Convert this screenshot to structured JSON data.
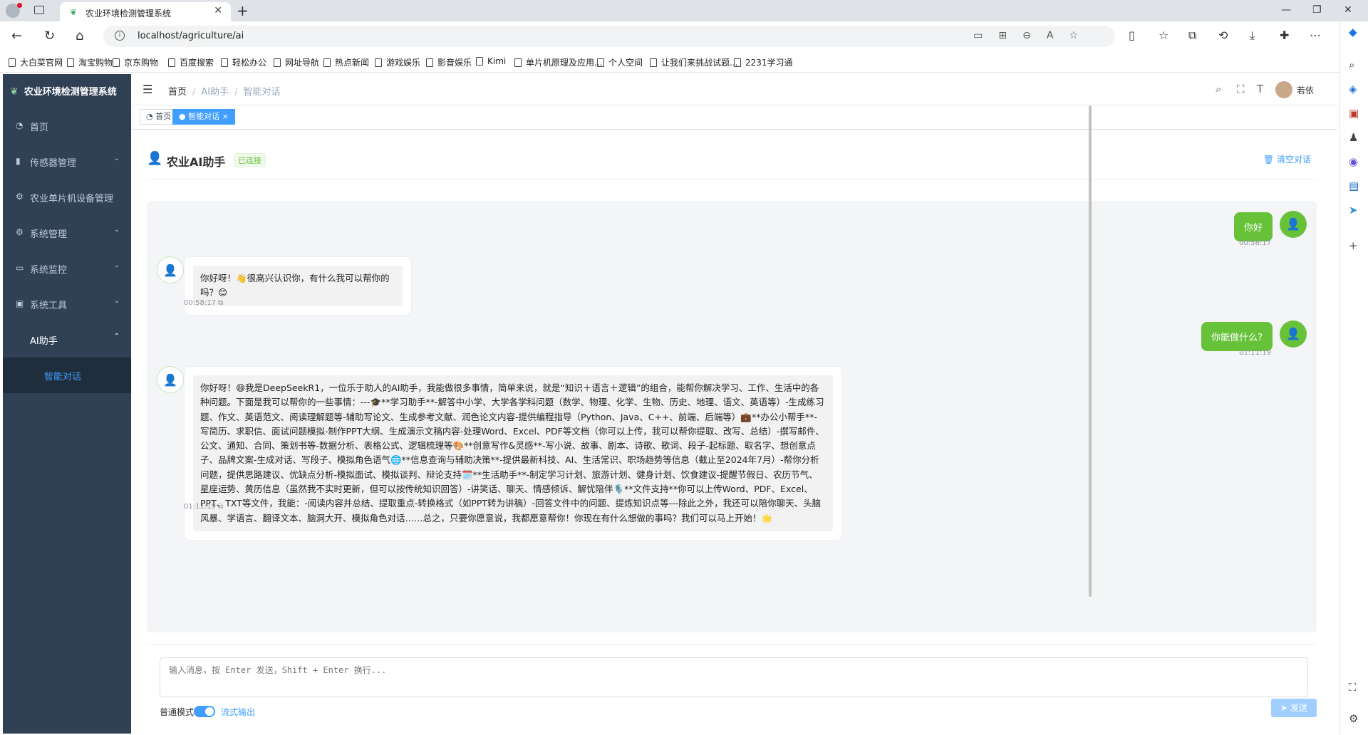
{
  "browser": {
    "tab_title": "农业环境检测管理系统",
    "url": "localhost/agriculture/ai",
    "bookmarks": [
      "大白菜官网",
      "淘宝购物",
      "京东购物",
      "百度搜索",
      "轻松办公",
      "网址导航",
      "热点新闻",
      "游戏娱乐",
      "影音娱乐",
      "Kimi",
      "单片机原理及应用...",
      "个人空间",
      "让我们来挑战试题...",
      "2231学习通"
    ]
  },
  "sidebar": {
    "logo": "农业环境检测管理系统",
    "items": [
      {
        "label": "首页",
        "icon": "dashboard-icon"
      },
      {
        "label": "传感器管理",
        "icon": "chart-icon"
      },
      {
        "label": "农业单片机设备管理",
        "icon": "gear-icon"
      },
      {
        "label": "系统管理",
        "icon": "gear-icon"
      },
      {
        "label": "系统监控",
        "icon": "monitor-icon"
      },
      {
        "label": "系统工具",
        "icon": "toolbox-icon"
      },
      {
        "label": "AI助手",
        "icon": ""
      },
      {
        "label": "智能对话",
        "icon": ""
      }
    ]
  },
  "navbar": {
    "breadcrumb": [
      "首页",
      "AI助手",
      "智能对话"
    ],
    "username": "若依"
  },
  "tags": {
    "home": "首页",
    "active": "智能对话"
  },
  "chat": {
    "title": "农业AI助手",
    "status": "已连接",
    "clear": "清空对话",
    "messages": [
      {
        "role": "user",
        "text": "你好",
        "time": "00:58:17"
      },
      {
        "role": "bot",
        "text": "你好呀！👋很高兴认识你，有什么我可以帮你的吗？😊",
        "time": "00:58:17"
      },
      {
        "role": "user",
        "text": "你能做什么?",
        "time": "01:11:19"
      },
      {
        "role": "bot",
        "text": "你好呀！😄我是DeepSeekR1，一位乐于助人的AI助手，我能做很多事情，简单来说，就是“知识＋语言＋逻辑”的组合，能帮你解决学习、工作、生活中的各种问题。下面是我可以帮你的一些事情：---🎓**学习助手**-解答中小学、大学各学科问题（数学、物理、化学、生物、历史、地理、语文、英语等）-生成练习题、作文、英语范文、阅读理解题等-辅助写论文、生成参考文献、润色论文内容-提供编程指导（Python、Java、C++、前端、后端等）💼**办公小帮手**-写简历、求职信、面试问题模拟-制作PPT大纲、生成演示文稿内容-处理Word、Excel、PDF等文档（你可以上传，我可以帮你提取、改写、总结）-撰写邮件、公文、通知、合同、策划书等-数据分析、表格公式、逻辑梳理等🎨**创意写作&灵感**-写小说、故事、剧本、诗歌、歌词、段子-起标题、取名字、想创意点子、品牌文案-生成对话、写段子、模拟角色语气🌐**信息查询与辅助决策**-提供最新科技、AI、生活常识、职场趋势等信息（截止至2024年7月）-帮你分析问题，提供思路建议、优缺点分析-模拟面试、模拟谈判、辩论支持🗓️**生活助手**-制定学习计划、旅游计划、健身计划、饮食建议-提醒节假日、农历节气、星座运势、黄历信息（虽然我不实时更新，但可以按传统知识回答）-讲笑话、聊天、情感倾诉、解忧陪伴🎙️**文件支持**你可以上传Word、PDF、Excel、PPT、TXT等文件，我能：-阅读内容并总结、提取重点-转换格式（如PPT转为讲稿）-回答文件中的问题、提炼知识点等---除此之外，我还可以陪你聊天、头脑风暴、学语言、翻译文本、脑洞大开、模拟角色对话……总之，只要你愿意说，我都愿意帮你！你现在有什么想做的事吗？我们可以马上开始！🌟",
        "time": "01:11:19"
      }
    ]
  },
  "input": {
    "placeholder": "输入消息，按 Enter 发送，Shift + Enter 换行...",
    "mode_label": "普通模式",
    "stream_label": "流式输出",
    "send": "发送",
    "stream_on": true
  },
  "colors": {
    "sidebar_bg": "#304156",
    "accent": "#409eff",
    "green": "#67c23a"
  }
}
